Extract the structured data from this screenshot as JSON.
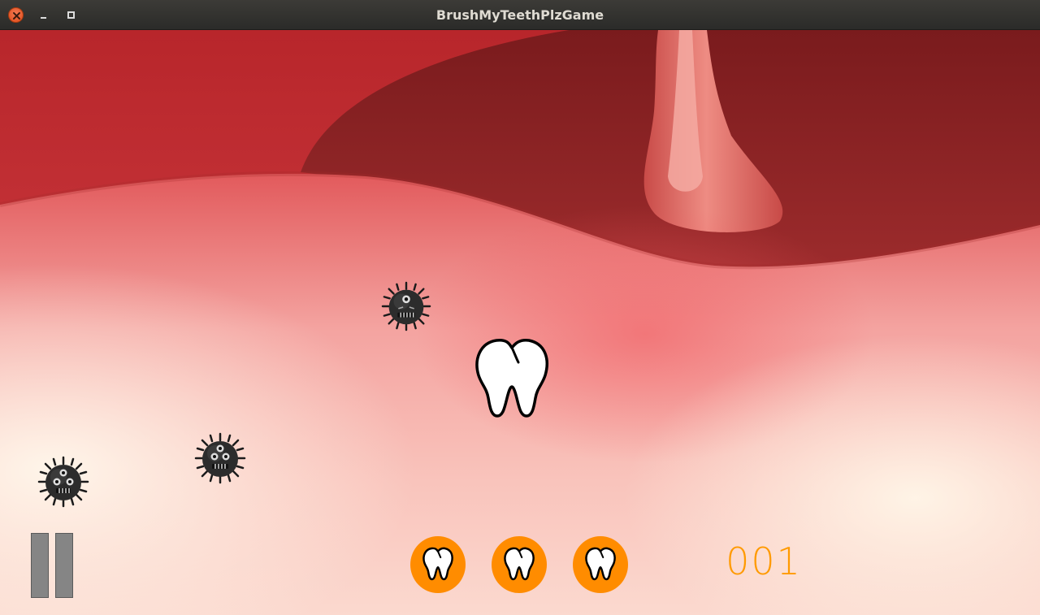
{
  "window": {
    "title": "BrushMyTeethPlzGame"
  },
  "hud": {
    "score": "001",
    "lives_remaining": 3,
    "life_icon": "tooth-icon",
    "pause_icon": "pause-icon"
  },
  "sprites": {
    "player": "tooth-icon",
    "enemy": "germ-icon",
    "enemy_count": 3
  },
  "colors": {
    "life_badge": "#ff8c00",
    "score_text": "#ff9a00",
    "pause_bars": "#858585"
  }
}
